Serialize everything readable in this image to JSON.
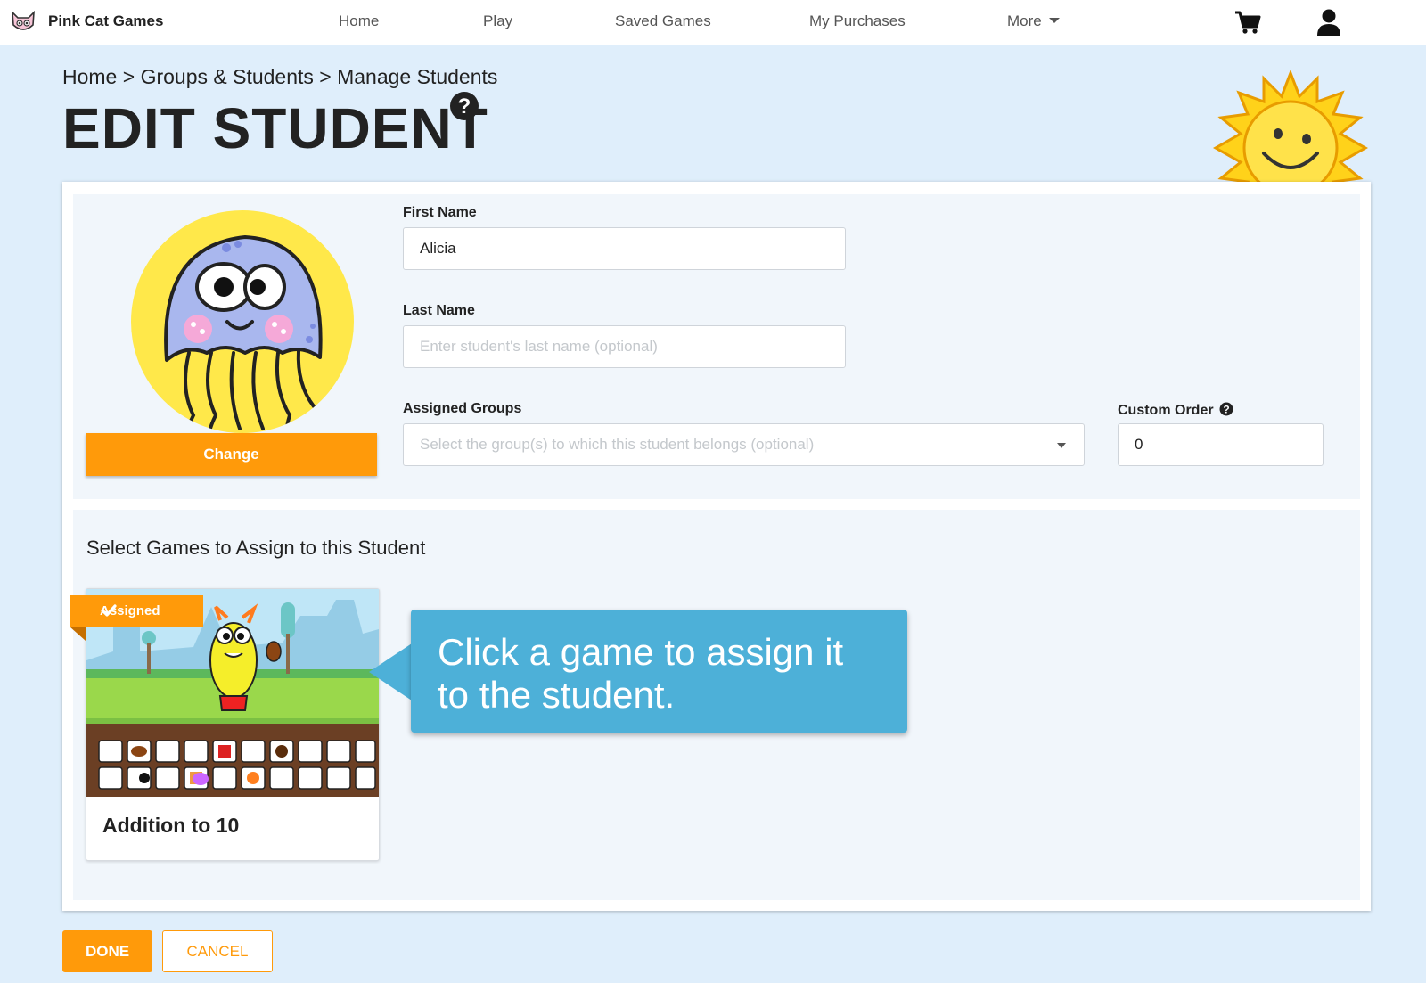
{
  "nav": {
    "brand": "Pink Cat Games",
    "links": [
      {
        "label": "Home"
      },
      {
        "label": "Play"
      },
      {
        "label": "Saved Games"
      },
      {
        "label": "My Purchases"
      },
      {
        "label": "More"
      }
    ],
    "icons": [
      "pink-cat-logo",
      "cart-icon",
      "user-icon"
    ]
  },
  "breadcrumb": "Home > Groups & Students > Manage Students",
  "page_title": "EDIT STUDENT",
  "avatar": {
    "icon": "jellyfish-avatar",
    "change_label": "Change"
  },
  "form": {
    "first_name": {
      "label": "First Name",
      "value": "Alicia"
    },
    "last_name": {
      "label": "Last Name",
      "placeholder": "Enter student's last name (optional)"
    },
    "groups": {
      "label": "Assigned Groups",
      "placeholder": "Select the group(s) to which this student belongs (optional)"
    },
    "custom_order": {
      "label": "Custom Order",
      "value": "0"
    }
  },
  "games_section": {
    "heading": "Select Games to Assign to this Student",
    "games": [
      {
        "title": "Addition to 10",
        "badge": "Assigned",
        "assigned": true
      }
    ]
  },
  "tooltip": {
    "text": "Click a game to assign it to the student."
  },
  "actions": {
    "done": "DONE",
    "cancel": "CANCEL"
  },
  "colors": {
    "accent": "#ff9a0a",
    "tooltip": "#4db0d8",
    "background": "#dfeefb"
  }
}
